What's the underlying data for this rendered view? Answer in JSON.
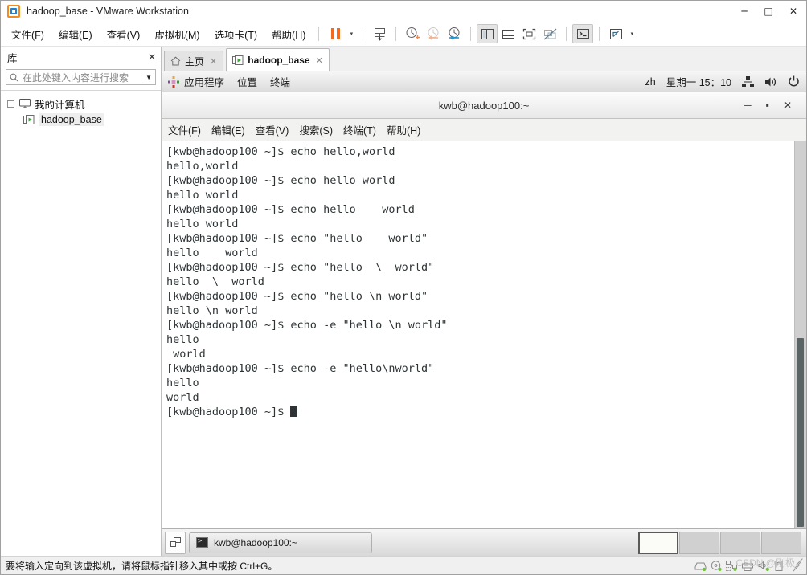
{
  "window": {
    "title": "hadoop_base - VMware Workstation",
    "controls": {
      "minimize": "─",
      "maximize": "□",
      "close": "✕"
    }
  },
  "menubar": {
    "items": [
      {
        "label": "文件(F)",
        "name": "menu-file"
      },
      {
        "label": "编辑(E)",
        "name": "menu-edit"
      },
      {
        "label": "查看(V)",
        "name": "menu-view"
      },
      {
        "label": "虚拟机(M)",
        "name": "menu-vm"
      },
      {
        "label": "选项卡(T)",
        "name": "menu-tabs"
      },
      {
        "label": "帮助(H)",
        "name": "menu-help"
      }
    ],
    "toolbar": {
      "pause": "pause-icon",
      "pause_caret": "▾",
      "send_cad": "send-ctrl-alt-del-icon",
      "snapshot": "take-snapshot-icon",
      "revert": "revert-snapshot-icon",
      "snapshot_manager": "snapshot-manager-icon",
      "show_library": "show-library-icon",
      "show_thumbnails": "show-thumbnail-bar-icon",
      "fullscreen": "full-screen-icon",
      "unity": "unity-mode-icon",
      "console": "console-view-icon",
      "stretch": "stretch-guest-icon",
      "stretch_caret": "▾"
    }
  },
  "sidebar": {
    "title": "库",
    "close": "✕",
    "search": {
      "placeholder": "在此处键入内容进行搜索",
      "value": "",
      "dropdown": "▼",
      "icon": "search-icon"
    },
    "tree": [
      {
        "label": "我的计算机",
        "icon": "monitor-icon",
        "expanded": true,
        "selected": false
      },
      {
        "label": "hadoop_base",
        "icon": "vm-running-icon",
        "expanded": false,
        "selected": true
      }
    ]
  },
  "tabs": [
    {
      "label": "主页",
      "icon": "home-icon",
      "active": false,
      "close": "✕"
    },
    {
      "label": "hadoop_base",
      "icon": "vm-running-icon",
      "active": true,
      "close": "✕"
    }
  ],
  "guest_panel": {
    "menus": [
      "应用程序",
      "位置",
      "终端"
    ],
    "app_icon": "gnome-foot-icon",
    "keyboard_layout": "zh",
    "clock": "星期一 15：10",
    "tray": [
      "network-icon",
      "volume-icon",
      "power-icon"
    ]
  },
  "terminal": {
    "title": "kwb@hadoop100:~",
    "controls": {
      "minimize": "─",
      "maximize": "▪",
      "close": "✕"
    },
    "menus": [
      "文件(F)",
      "编辑(E)",
      "查看(V)",
      "搜索(S)",
      "终端(T)",
      "帮助(H)"
    ],
    "lines": [
      "[kwb@hadoop100 ~]$ echo hello,world",
      "hello,world",
      "[kwb@hadoop100 ~]$ echo hello world",
      "hello world",
      "[kwb@hadoop100 ~]$ echo hello    world",
      "hello world",
      "[kwb@hadoop100 ~]$ echo \"hello    world\"",
      "hello    world",
      "[kwb@hadoop100 ~]$ echo \"hello  \\  world\"",
      "hello  \\  world",
      "[kwb@hadoop100 ~]$ echo \"hello \\n world\"",
      "hello \\n world",
      "[kwb@hadoop100 ~]$ echo -e \"hello \\n world\"",
      "hello",
      " world",
      "[kwb@hadoop100 ~]$ echo -e \"hello\\nworld\"",
      "hello",
      "world"
    ],
    "prompt": "[kwb@hadoop100 ~]$ "
  },
  "guest_taskbar": {
    "show_desktop": "show-desktop-icon",
    "tasks": [
      {
        "label": "kwb@hadoop100:~",
        "icon": "terminal-icon",
        "active": true
      }
    ],
    "workspaces": [
      {
        "active": true
      },
      {
        "active": false
      },
      {
        "active": false
      },
      {
        "active": false
      }
    ]
  },
  "statusbar": {
    "text": "要将输入定向到该虚拟机，请将鼠标指针移入其中或按 Ctrl+G。",
    "devices": [
      "hard-disk-icon",
      "cd-drive-icon",
      "network-adapter-icon",
      "printer-icon",
      "sound-card-icon",
      "usb-icon"
    ],
    "watermark": "CSDN @刚极"
  }
}
